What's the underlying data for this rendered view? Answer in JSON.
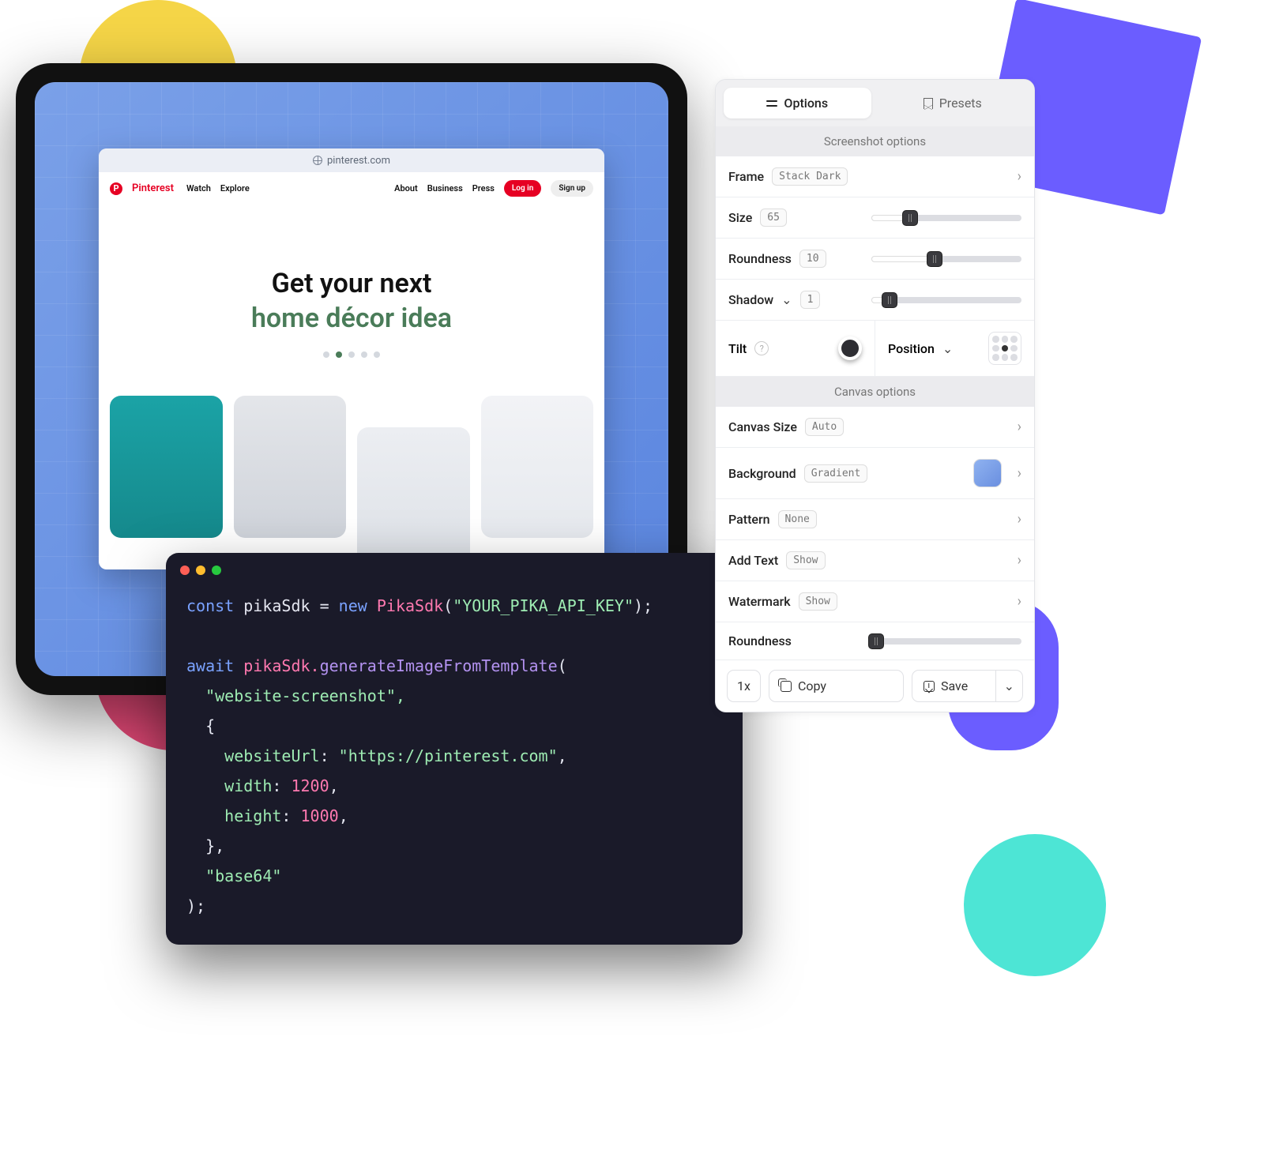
{
  "browser": {
    "url": "pinterest.com",
    "brand": "Pinterest",
    "nav": {
      "watch": "Watch",
      "explore": "Explore",
      "about": "About",
      "business": "Business",
      "press": "Press",
      "login": "Log in",
      "signup": "Sign up"
    },
    "hero_line1": "Get your next",
    "hero_line2": "home décor idea"
  },
  "code": {
    "l1a": "const",
    "l1b": " pikaSdk ",
    "l1c": "=",
    "l1d": " new ",
    "l1e": "PikaSdk",
    "l1f": "(",
    "l1g": "\"YOUR_PIKA_API_KEY\"",
    "l1h": ");",
    "l2a": "await",
    "l2b": " pikaSdk.",
    "l2c": "generateImageFromTemplate",
    "l2d": "(",
    "l3": "  \"website-screenshot\",",
    "l4": "  {",
    "l5a": "    websiteUrl",
    "l5b": ": ",
    "l5c": "\"https://pinterest.com\"",
    "l5d": ",",
    "l6a": "    width",
    "l6b": ": ",
    "l6c": "1200",
    "l6d": ",",
    "l7a": "    height",
    "l7b": ": ",
    "l7c": "1000",
    "l7d": ",",
    "l8": "  },",
    "l9": "  \"base64\"",
    "l10": ");"
  },
  "panel": {
    "tab_options": "Options",
    "tab_presets": "Presets",
    "sec_screenshot": "Screenshot options",
    "sec_canvas": "Canvas options",
    "frame": {
      "label": "Frame",
      "value": "Stack Dark"
    },
    "size": {
      "label": "Size",
      "value": "65",
      "percent": 26
    },
    "roundness": {
      "label": "Roundness",
      "value": "10",
      "percent": 42
    },
    "shadow": {
      "label": "Shadow",
      "value": "1",
      "percent": 12
    },
    "tilt": "Tilt",
    "position": "Position",
    "canvas_size": {
      "label": "Canvas Size",
      "value": "Auto"
    },
    "background": {
      "label": "Background",
      "value": "Gradient"
    },
    "pattern": {
      "label": "Pattern",
      "value": "None"
    },
    "add_text": {
      "label": "Add Text",
      "value": "Show"
    },
    "watermark": {
      "label": "Watermark",
      "value": "Show"
    },
    "roundness2": {
      "label": "Roundness",
      "percent": 3
    },
    "actions": {
      "scale": "1x",
      "copy": "Copy",
      "save": "Save"
    }
  }
}
